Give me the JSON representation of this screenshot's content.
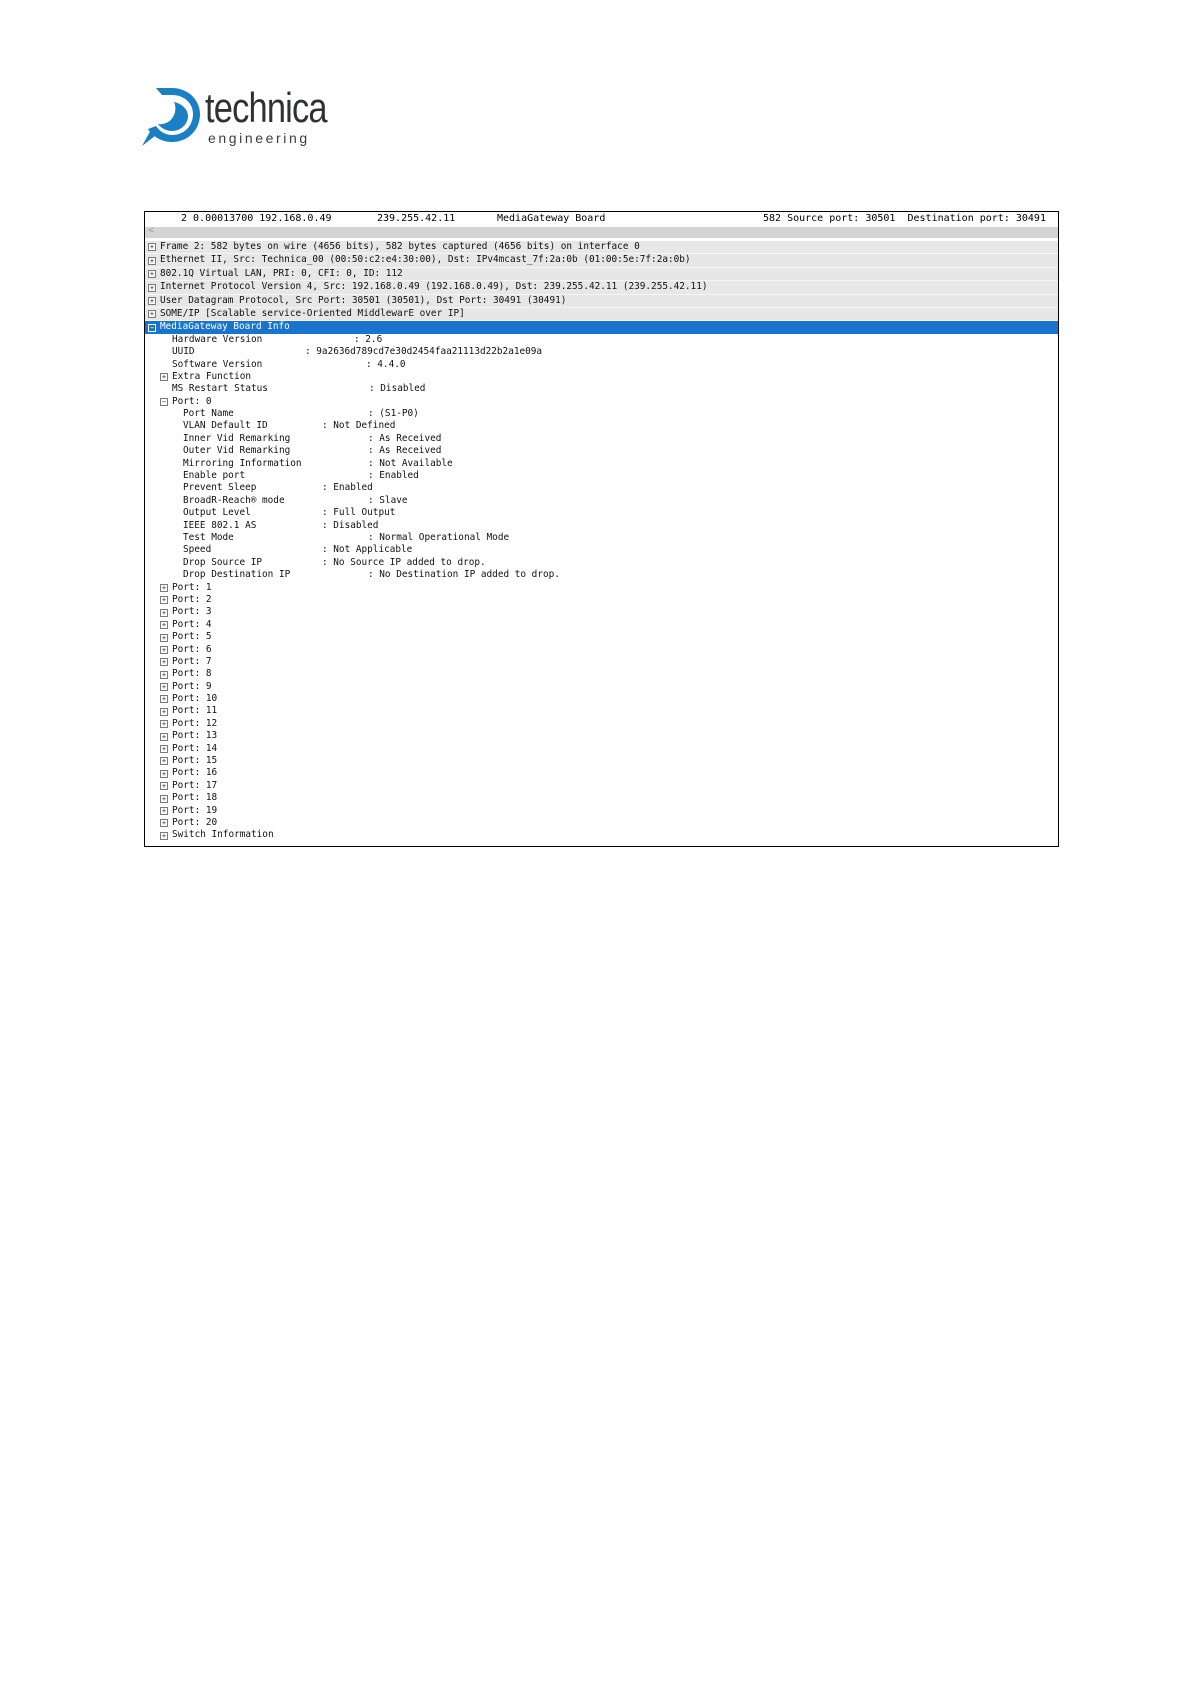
{
  "logo": {
    "word": "technica",
    "sub": "engineering"
  },
  "summary": {
    "no_time_src": "2 0.00013700 192.168.0.49",
    "dst": "239.255.42.11",
    "proto": "MediaGateway Board",
    "info": "582 Source port: 30501  Destination port: 30491"
  },
  "scroll_arrow": "<",
  "protocols": [
    "Frame 2: 582 bytes on wire (4656 bits), 582 bytes captured (4656 bits) on interface 0",
    "Ethernet II, Src: Technica_00 (00:50:c2:e4:30:00), Dst: IPv4mcast_7f:2a:0b (01:00:5e:7f:2a:0b)",
    "802.1Q Virtual LAN, PRI: 0, CFI: 0, ID: 112",
    "Internet Protocol Version 4, Src: 192.168.0.49 (192.168.0.49), Dst: 239.255.42.11 (239.255.42.11)",
    "User Datagram Protocol, Src Port: 30501 (30501), Dst Port: 30491 (30491)",
    "SOME/IP [Scalable service-Oriented MiddlewarE over IP]"
  ],
  "selected": "MediaGateway Board Info",
  "board_fields": [
    {
      "label": "Hardware Version",
      "value": ": 2.6"
    },
    {
      "label": "UUID",
      "value": ": 9a2636d789cd7e30d2454faa21113d22b2a1e09a"
    },
    {
      "label": "Software Version",
      "value": ": 4.4.0"
    },
    {
      "label": "Extra Function",
      "value": ""
    },
    {
      "label": "MS Restart Status",
      "value": ": Disabled"
    }
  ],
  "port0_label": "Port: 0",
  "port0_fields": [
    {
      "label": "Port Name",
      "value": ": (S1-P0)"
    },
    {
      "label": "VLAN Default ID",
      "value": ": Not Defined"
    },
    {
      "label": "Inner Vid Remarking",
      "value": ": As Received"
    },
    {
      "label": "Outer Vid Remarking",
      "value": ": As Received"
    },
    {
      "label": "Mirroring Information",
      "value": ": Not Available"
    },
    {
      "label": "Enable port",
      "value": ": Enabled"
    },
    {
      "label": "Prevent Sleep",
      "value": ": Enabled"
    },
    {
      "label": "BroadR-Reach® mode",
      "value": ": Slave"
    },
    {
      "label": "Output Level",
      "value": ": Full Output"
    },
    {
      "label": "IEEE 802.1 AS",
      "value": ": Disabled"
    },
    {
      "label": "Test Mode",
      "value": ": Normal Operational Mode"
    },
    {
      "label": "Speed",
      "value": ": Not Applicable"
    },
    {
      "label": "Drop Source IP",
      "value": ": No Source IP added to drop."
    },
    {
      "label": "Drop Destination IP",
      "value": ": No Destination IP added to drop."
    }
  ],
  "ports": [
    "Port: 1",
    "Port: 2",
    "Port: 3",
    "Port: 4",
    "Port: 5",
    "Port: 6",
    "Port: 7",
    "Port: 8",
    "Port: 9",
    "Port: 10",
    "Port: 11",
    "Port: 12",
    "Port: 13",
    "Port: 14",
    "Port: 15",
    "Port: 16",
    "Port: 17",
    "Port: 18",
    "Port: 19",
    "Port: 20"
  ],
  "switch_info": "Switch Information",
  "colors": {
    "selection": "#1874cd",
    "logo_blue": "#1a7fc4"
  }
}
